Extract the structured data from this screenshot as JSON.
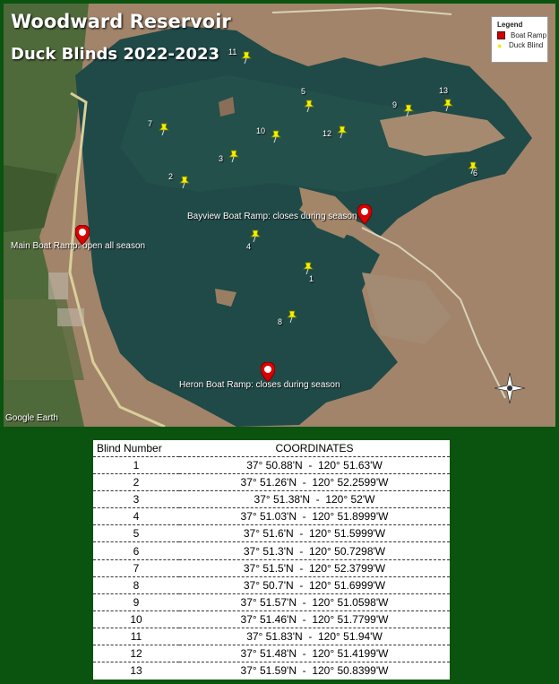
{
  "map": {
    "title_line1": "Woodward Reservoir",
    "title_line2": "Duck Blinds 2022-2023",
    "attribution": "Google Earth",
    "legend": {
      "title": "Legend",
      "items": [
        {
          "label": "Boat Ramp",
          "icon": "boat-ramp-icon",
          "color": "#cc0000"
        },
        {
          "label": "Duck Blind",
          "icon": "pushpin-icon",
          "color": "#eeee00"
        }
      ]
    },
    "ramps": [
      {
        "label": "Bayview Boat Ramp: closes during season"
      },
      {
        "label": "Main Boat Ramp: open all season"
      },
      {
        "label": "Heron Boat Ramp: closes during season"
      }
    ],
    "blind_labels": [
      "1",
      "2",
      "3",
      "4",
      "5",
      "6",
      "7",
      "8",
      "9",
      "10",
      "11",
      "12",
      "13"
    ]
  },
  "table": {
    "headers": {
      "number": "Blind Number",
      "coords": "COORDINATES"
    },
    "rows": [
      {
        "number": "1",
        "coords": "37° 50.88'N  -  120° 51.63'W"
      },
      {
        "number": "2",
        "coords": "37° 51.26'N  -  120° 52.2599'W"
      },
      {
        "number": "3",
        "coords": "37° 51.38'N  -  120° 52'W"
      },
      {
        "number": "4",
        "coords": "37° 51.03'N  -  120° 51.8999'W"
      },
      {
        "number": "5",
        "coords": "37° 51.6'N  -  120° 51.5999'W"
      },
      {
        "number": "6",
        "coords": "37° 51.3'N  -  120° 50.7298'W"
      },
      {
        "number": "7",
        "coords": "37° 51.5'N  -  120° 52.3799'W"
      },
      {
        "number": "8",
        "coords": "37° 50.7'N  -  120° 51.6999'W"
      },
      {
        "number": "9",
        "coords": "37° 51.57'N  -  120° 51.0598'W"
      },
      {
        "number": "10",
        "coords": "37° 51.46'N  -  120° 51.7799'W"
      },
      {
        "number": "11",
        "coords": "37° 51.83'N  -  120° 51.94'W"
      },
      {
        "number": "12",
        "coords": "37° 51.48'N  -  120° 51.4199'W"
      },
      {
        "number": "13",
        "coords": "37° 51.59'N  -  120° 50.8399'W"
      }
    ]
  }
}
